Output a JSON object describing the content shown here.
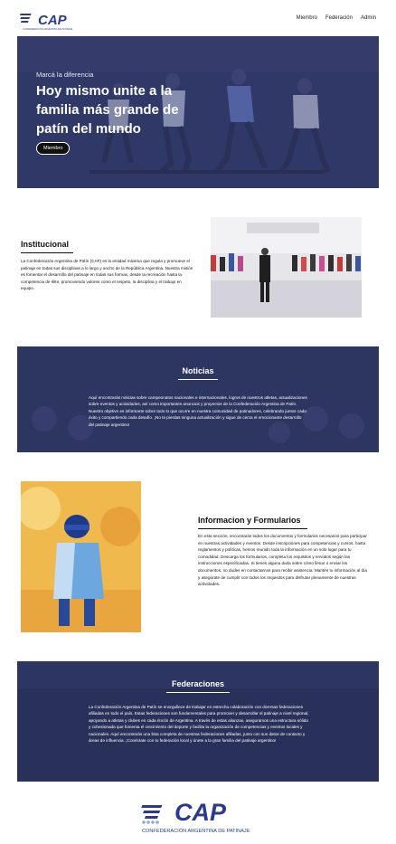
{
  "header": {
    "logo_text": "CAP",
    "logo_subtitle": "CONFEDERACIÓN ARGENTINA DE PATINAJE",
    "nav": [
      "Miembro",
      "Federación",
      "Admin"
    ]
  },
  "hero": {
    "kicker": "Marcá la diferencia",
    "title": "Hoy mismo unite a la familia más grande de patín del mundo",
    "button": "Miembro"
  },
  "institucional": {
    "title": "Institucional",
    "body": "La Confederación Argentina de Patín (CAP) es la entidad máxima que regula y promueve el patinaje en todas sus disciplinas a lo largo y ancho de la República Argentina. Nuestra misión es fomentar el desarrollo del patinaje en todas sus formas, desde la recreación hasta la competencia de élite, promoviendo valores como el respeto, la disciplina y el trabajo en equipo."
  },
  "noticias": {
    "title": "Noticias",
    "body": "Aquí encontrarás noticias sobre campeonatos nacionales e internacionales, logros de nuestros atletas, actualizaciones sobre eventos y actividades, así como importantes anuncios y proyectos de la Confederación Argentina de Patín. Nuestro objetivo es informarte sobre todo lo que ocurre en nuestra comunidad de patinadores, celebrando juntos cada éxito y compartiendo cada desafío. ¡No te pierdas ninguna actualización y sigue de cerca el emocionante desarrollo del patinaje argentino!"
  },
  "informacion": {
    "title": "Informacion y Formularios",
    "body": "En esta sección, encontrarás todos los documentos y formularios necesarios para participar en nuestras actividades y eventos. Desde inscripciones para competencias y cursos, hasta reglamentos y políticas, hemos reunido toda la información en un solo lugar para tu comodidad. Descarga los formularios, completa los requisitos y envíalos según las instrucciones especificadas. Si tienes alguna duda sobre cómo llenar o enviar los documentos, no dudes en contactarnos para recibir asistencia. Mantén tu información al día y asegúrate de cumplir con todos los requisitos para disfrutar plenamente de nuestras actividades."
  },
  "federaciones": {
    "title": "Federaciones",
    "body": "La Confederación Argentina de Patín se enorgullece de trabajar en estrecha colaboración con diversas federaciones afiliadas en todo el país. Estas federaciones son fundamentales para promover y desarrollar el patinaje a nivel regional, apoyando a atletas y clubes en cada rincón de Argentina. A través de estas alianzas, aseguramos una estructura sólida y cohesionada que fomenta el crecimiento del deporte y facilita la organización de competencias y eventos locales y nacionales. Aquí encontrarás una lista completa de nuestras federaciones afiliadas, junto con sus datos de contacto y áreas de influencia. ¡Conéctate con tu federación local y únete a la gran familia del patinaje argentino!"
  },
  "colors": {
    "brand_blue": "#2b3a8c",
    "band_bg": "#2f3762"
  }
}
